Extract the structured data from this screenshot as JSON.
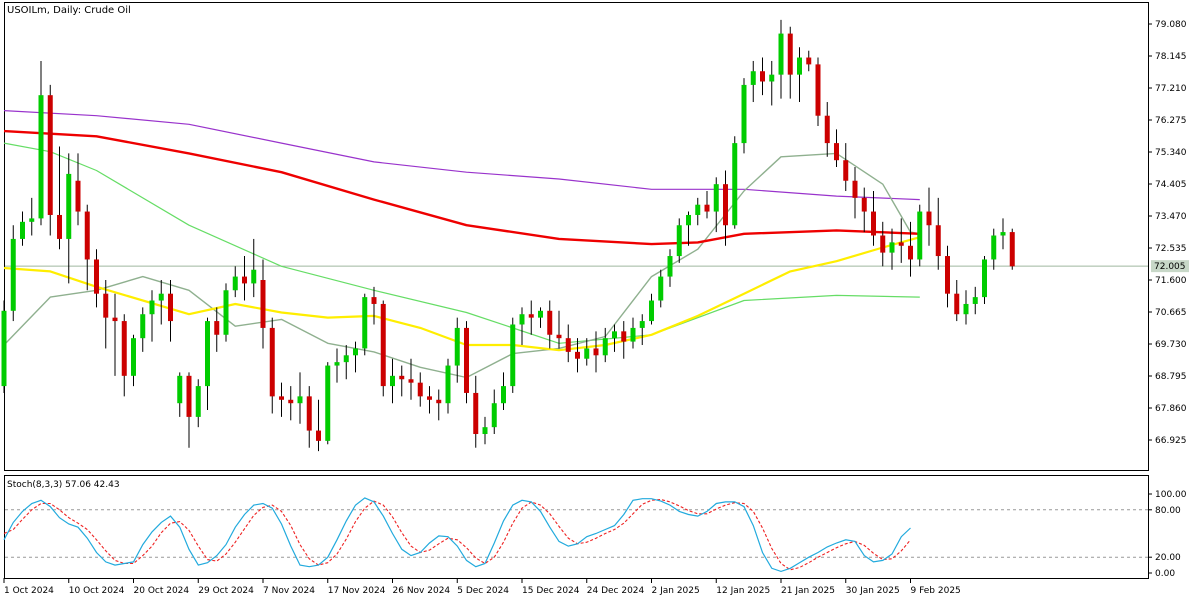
{
  "window": {
    "title": "USOILm, Daily:  Crude Oil"
  },
  "colors": {
    "background": "#ffffff",
    "bull": "#00cc00",
    "bear": "#cc0000",
    "wick": "#000000",
    "sma_fast_grey": "#8fb08f",
    "sma_yellow": "#ffee00",
    "sma_green": "#66dd66",
    "sma_red": "#ee0000",
    "sma_purple": "#9933cc",
    "stoch_main": "#22aadd",
    "stoch_signal": "#ee2222",
    "last_price_bg": "#c8d8c8"
  },
  "chart_data": [
    {
      "type": "candlestick",
      "title": "USOILm, Daily:  Crude Oil",
      "y_ticks": [
        "79.080",
        "78.145",
        "77.210",
        "76.275",
        "75.340",
        "74.405",
        "73.470",
        "72.535",
        "71.600",
        "70.665",
        "69.730",
        "68.795",
        "67.860",
        "66.925"
      ],
      "ylim": [
        66.3,
        79.5
      ],
      "last_price": "72.005",
      "x_ticks": [
        {
          "label": "1 Oct 2024",
          "index": 0
        },
        {
          "label": "10 Oct 2024",
          "index": 7
        },
        {
          "label": "20 Oct 2024",
          "index": 14
        },
        {
          "label": "29 Oct 2024",
          "index": 21
        },
        {
          "label": "7 Nov 2024",
          "index": 28
        },
        {
          "label": "17 Nov 2024",
          "index": 35
        },
        {
          "label": "26 Nov 2024",
          "index": 42
        },
        {
          "label": "5 Dec 2024",
          "index": 49
        },
        {
          "label": "15 Dec 2024",
          "index": 56
        },
        {
          "label": "24 Dec 2024",
          "index": 63
        },
        {
          "label": "2 Jan 2025",
          "index": 70
        },
        {
          "label": "12 Jan 2025",
          "index": 77
        },
        {
          "label": "21 Jan 2025",
          "index": 84
        },
        {
          "label": "30 Jan 2025",
          "index": 91
        },
        {
          "label": "9 Feb 2025",
          "index": 98
        }
      ],
      "candles": [
        [
          68.5,
          71.0,
          68.3,
          70.7
        ],
        [
          70.7,
          73.2,
          70.4,
          72.8
        ],
        [
          72.8,
          73.6,
          72.6,
          73.3
        ],
        [
          73.3,
          74.0,
          72.9,
          73.4
        ],
        [
          73.4,
          78.0,
          73.2,
          77.0
        ],
        [
          77.0,
          77.3,
          72.9,
          73.5
        ],
        [
          73.5,
          75.5,
          72.5,
          72.8
        ],
        [
          72.8,
          75.3,
          71.5,
          74.7
        ],
        [
          74.5,
          75.3,
          73.2,
          73.6
        ],
        [
          73.6,
          73.8,
          71.3,
          72.2
        ],
        [
          72.2,
          72.5,
          70.8,
          71.2
        ],
        [
          71.2,
          71.6,
          69.6,
          70.5
        ],
        [
          70.5,
          71.2,
          68.8,
          70.4
        ],
        [
          70.4,
          70.6,
          68.2,
          68.8
        ],
        [
          68.8,
          70.0,
          68.5,
          69.9
        ],
        [
          69.9,
          70.8,
          69.5,
          70.6
        ],
        [
          70.6,
          71.3,
          69.8,
          71.0
        ],
        [
          71.0,
          71.6,
          70.3,
          71.2
        ],
        [
          71.2,
          71.6,
          69.8,
          70.4
        ],
        [
          68.0,
          68.9,
          67.6,
          68.8
        ],
        [
          68.8,
          68.9,
          66.7,
          67.6
        ],
        [
          67.6,
          68.7,
          67.3,
          68.5
        ],
        [
          68.5,
          70.5,
          67.8,
          70.4
        ],
        [
          70.4,
          70.8,
          69.5,
          70.0
        ],
        [
          70.0,
          71.5,
          69.8,
          71.3
        ],
        [
          71.3,
          72.0,
          71.1,
          71.7
        ],
        [
          71.7,
          72.3,
          71.0,
          71.5
        ],
        [
          71.5,
          72.8,
          71.1,
          71.9
        ],
        [
          71.6,
          72.2,
          69.6,
          70.2
        ],
        [
          70.2,
          70.5,
          67.7,
          68.2
        ],
        [
          68.2,
          68.6,
          67.6,
          68.1
        ],
        [
          68.1,
          68.5,
          67.5,
          68.0
        ],
        [
          68.0,
          68.9,
          67.4,
          68.2
        ],
        [
          68.2,
          68.5,
          66.7,
          67.2
        ],
        [
          67.2,
          68.1,
          66.6,
          66.9
        ],
        [
          66.9,
          69.2,
          66.8,
          69.1
        ],
        [
          69.1,
          69.6,
          68.6,
          69.2
        ],
        [
          69.2,
          69.7,
          68.7,
          69.4
        ],
        [
          69.4,
          69.8,
          68.9,
          69.6
        ],
        [
          69.6,
          71.2,
          69.4,
          71.1
        ],
        [
          71.1,
          71.4,
          70.3,
          70.9
        ],
        [
          70.9,
          71.0,
          68.2,
          68.5
        ],
        [
          68.5,
          69.3,
          68.0,
          68.8
        ],
        [
          68.8,
          69.1,
          68.2,
          68.7
        ],
        [
          68.7,
          69.3,
          68.1,
          68.6
        ],
        [
          68.6,
          68.9,
          67.9,
          68.2
        ],
        [
          68.2,
          68.5,
          67.7,
          68.1
        ],
        [
          68.1,
          68.4,
          67.5,
          68.0
        ],
        [
          68.0,
          69.3,
          67.7,
          69.1
        ],
        [
          69.1,
          70.5,
          68.6,
          70.2
        ],
        [
          70.2,
          70.4,
          68.0,
          68.3
        ],
        [
          68.3,
          68.8,
          66.7,
          67.1
        ],
        [
          67.1,
          67.6,
          66.8,
          67.3
        ],
        [
          67.3,
          68.4,
          67.1,
          68.0
        ],
        [
          68.0,
          68.9,
          67.8,
          68.5
        ],
        [
          68.5,
          70.5,
          68.3,
          70.3
        ],
        [
          70.3,
          70.8,
          69.7,
          70.6
        ],
        [
          70.6,
          71.0,
          70.0,
          70.5
        ],
        [
          70.5,
          70.8,
          70.2,
          70.7
        ],
        [
          70.7,
          71.0,
          69.6,
          70.0
        ],
        [
          70.0,
          70.7,
          69.6,
          69.9
        ],
        [
          69.9,
          70.3,
          69.2,
          69.5
        ],
        [
          69.5,
          69.9,
          68.9,
          69.3
        ],
        [
          69.3,
          69.9,
          69.1,
          69.6
        ],
        [
          69.6,
          70.1,
          68.9,
          69.4
        ],
        [
          69.4,
          70.2,
          69.2,
          69.9
        ],
        [
          69.9,
          70.3,
          69.5,
          70.1
        ],
        [
          70.1,
          70.4,
          69.3,
          69.8
        ],
        [
          69.8,
          70.5,
          69.6,
          70.2
        ],
        [
          70.2,
          70.6,
          69.7,
          70.4
        ],
        [
          70.4,
          71.2,
          70.3,
          71.0
        ],
        [
          71.0,
          71.9,
          70.8,
          71.7
        ],
        [
          71.7,
          72.5,
          71.4,
          72.3
        ],
        [
          72.3,
          73.4,
          72.1,
          73.2
        ],
        [
          73.2,
          73.6,
          72.6,
          73.5
        ],
        [
          73.5,
          74.0,
          73.2,
          73.8
        ],
        [
          73.8,
          74.2,
          73.4,
          73.6
        ],
        [
          73.6,
          74.6,
          73.0,
          74.4
        ],
        [
          74.4,
          74.8,
          72.6,
          73.2
        ],
        [
          73.2,
          75.8,
          73.1,
          75.6
        ],
        [
          75.6,
          77.5,
          75.3,
          77.3
        ],
        [
          77.3,
          78.0,
          76.8,
          77.7
        ],
        [
          77.7,
          78.1,
          77.0,
          77.4
        ],
        [
          77.4,
          78.0,
          76.7,
          77.6
        ],
        [
          77.6,
          79.2,
          76.9,
          78.8
        ],
        [
          78.8,
          79.0,
          76.9,
          77.6
        ],
        [
          77.6,
          78.4,
          76.8,
          78.1
        ],
        [
          78.1,
          78.3,
          77.7,
          77.9
        ],
        [
          77.9,
          78.1,
          76.1,
          76.4
        ],
        [
          76.4,
          76.8,
          75.2,
          75.6
        ],
        [
          75.6,
          76.0,
          74.9,
          75.1
        ],
        [
          75.1,
          75.6,
          74.2,
          74.5
        ],
        [
          74.5,
          74.9,
          73.4,
          74.0
        ],
        [
          74.0,
          74.3,
          73.0,
          73.6
        ],
        [
          73.6,
          74.2,
          72.6,
          72.9
        ],
        [
          72.9,
          73.3,
          72.0,
          72.4
        ],
        [
          72.4,
          73.1,
          71.9,
          72.7
        ],
        [
          72.7,
          73.4,
          72.1,
          72.6
        ],
        [
          72.6,
          73.3,
          71.7,
          72.2
        ],
        [
          72.2,
          73.8,
          72.0,
          73.6
        ],
        [
          73.6,
          74.3,
          72.6,
          73.2
        ],
        [
          73.2,
          74.0,
          71.9,
          72.3
        ],
        [
          72.3,
          72.6,
          70.8,
          71.2
        ],
        [
          71.2,
          71.6,
          70.4,
          70.6
        ],
        [
          70.6,
          71.3,
          70.3,
          70.9
        ],
        [
          70.9,
          71.4,
          70.6,
          71.1
        ],
        [
          71.1,
          72.3,
          70.9,
          72.2
        ],
        [
          72.2,
          73.1,
          71.9,
          72.9
        ],
        [
          72.9,
          73.4,
          72.5,
          73.0
        ],
        [
          73.0,
          73.1,
          71.9,
          72.0
        ]
      ],
      "sma_purple": [
        [
          0,
          76.55
        ],
        [
          10,
          76.4
        ],
        [
          20,
          76.15
        ],
        [
          30,
          75.6
        ],
        [
          40,
          75.05
        ],
        [
          50,
          74.75
        ],
        [
          60,
          74.55
        ],
        [
          70,
          74.25
        ],
        [
          80,
          74.25
        ],
        [
          90,
          74.05
        ],
        [
          99,
          73.95
        ]
      ],
      "sma_red": [
        [
          0,
          75.95
        ],
        [
          10,
          75.8
        ],
        [
          20,
          75.3
        ],
        [
          30,
          74.75
        ],
        [
          40,
          73.95
        ],
        [
          50,
          73.2
        ],
        [
          60,
          72.8
        ],
        [
          70,
          72.65
        ],
        [
          75,
          72.7
        ],
        [
          80,
          72.95
        ],
        [
          90,
          73.05
        ],
        [
          99,
          72.95
        ]
      ],
      "sma_green": [
        [
          0,
          75.6
        ],
        [
          5,
          75.35
        ],
        [
          10,
          74.8
        ],
        [
          20,
          73.2
        ],
        [
          30,
          72.0
        ],
        [
          40,
          71.3
        ],
        [
          50,
          70.65
        ],
        [
          60,
          69.75
        ],
        [
          70,
          70.0
        ],
        [
          80,
          71.0
        ],
        [
          90,
          71.15
        ],
        [
          99,
          71.1
        ]
      ],
      "sma_yellow": [
        [
          0,
          71.95
        ],
        [
          5,
          71.85
        ],
        [
          10,
          71.4
        ],
        [
          20,
          70.6
        ],
        [
          25,
          70.9
        ],
        [
          30,
          70.65
        ],
        [
          35,
          70.5
        ],
        [
          40,
          70.55
        ],
        [
          45,
          70.2
        ],
        [
          50,
          69.7
        ],
        [
          55,
          69.7
        ],
        [
          60,
          69.55
        ],
        [
          65,
          69.7
        ],
        [
          70,
          70.0
        ],
        [
          75,
          70.55
        ],
        [
          80,
          71.2
        ],
        [
          85,
          71.85
        ],
        [
          90,
          72.15
        ],
        [
          95,
          72.55
        ],
        [
          99,
          72.85
        ]
      ],
      "sma_grey": [
        [
          0,
          69.7
        ],
        [
          5,
          71.1
        ],
        [
          10,
          71.3
        ],
        [
          15,
          71.7
        ],
        [
          20,
          71.3
        ],
        [
          25,
          70.25
        ],
        [
          30,
          70.45
        ],
        [
          35,
          69.75
        ],
        [
          40,
          69.5
        ],
        [
          45,
          69.05
        ],
        [
          50,
          68.75
        ],
        [
          55,
          69.45
        ],
        [
          60,
          69.6
        ],
        [
          65,
          69.95
        ],
        [
          70,
          71.7
        ],
        [
          75,
          72.5
        ],
        [
          80,
          74.2
        ],
        [
          84,
          75.2
        ],
        [
          90,
          75.3
        ],
        [
          95,
          74.4
        ],
        [
          98,
          73.0
        ],
        [
          99,
          72.95
        ]
      ]
    },
    {
      "type": "line",
      "title": "Stoch(8,3,3) 57.06 42.43",
      "y_ticks": [
        "100.00",
        "80.00",
        "20.00",
        "0.00"
      ],
      "ylim": [
        -3,
        105
      ],
      "levels": [
        80,
        20
      ],
      "series": [
        {
          "values": [
            42,
            64,
            78,
            88,
            92,
            84,
            70,
            62,
            58,
            44,
            26,
            14,
            10,
            12,
            14,
            36,
            52,
            64,
            72,
            58,
            30,
            10,
            13,
            22,
            36,
            58,
            74,
            86,
            88,
            82,
            62,
            34,
            10,
            8,
            10,
            20,
            42,
            66,
            86,
            95,
            90,
            72,
            50,
            30,
            22,
            26,
            38,
            47,
            46,
            34,
            16,
            8,
            12,
            38,
            66,
            86,
            92,
            90,
            78,
            58,
            40,
            34,
            37,
            46,
            50,
            55,
            60,
            74,
            92,
            94,
            94,
            91,
            86,
            78,
            74,
            72,
            78,
            88,
            90,
            90,
            84,
            60,
            26,
            6,
            2,
            6,
            13,
            20,
            26,
            33,
            38,
            42,
            40,
            22,
            14,
            16,
            24,
            46,
            57
          ]
        },
        {
          "values": [
            50,
            55,
            68,
            80,
            88,
            88,
            80,
            70,
            63,
            55,
            42,
            28,
            16,
            12,
            12,
            22,
            34,
            51,
            63,
            65,
            54,
            34,
            17,
            15,
            24,
            39,
            56,
            73,
            83,
            86,
            78,
            60,
            36,
            18,
            10,
            13,
            24,
            43,
            65,
            82,
            91,
            86,
            71,
            51,
            34,
            26,
            29,
            37,
            44,
            42,
            32,
            19,
            12,
            20,
            39,
            63,
            82,
            90,
            86,
            75,
            59,
            44,
            37,
            39,
            44,
            50,
            55,
            63,
            75,
            87,
            92,
            93,
            90,
            85,
            79,
            75,
            75,
            81,
            86,
            89,
            88,
            78,
            57,
            31,
            12,
            4,
            7,
            13,
            20,
            26,
            32,
            37,
            40,
            35,
            25,
            17,
            18,
            28,
            42
          ]
        }
      ]
    }
  ]
}
